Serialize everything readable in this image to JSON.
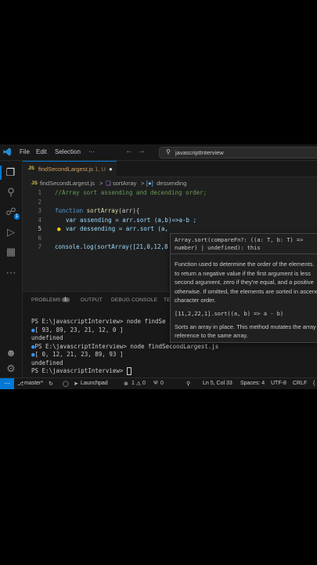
{
  "titlebar": {
    "menu": [
      "File",
      "Edit",
      "Selection",
      "···"
    ],
    "search_text": "javascriptInterview"
  },
  "tab": {
    "name": "findSecondLargest.js",
    "suffix": "1, U",
    "lang": "JS"
  },
  "breadcrumbs": [
    "findSecondLargest.js",
    ">",
    "sortArray",
    ">",
    "dessending"
  ],
  "editor": {
    "line_numbers": [
      "1",
      "2",
      "3",
      "4",
      "5",
      "6",
      "7"
    ],
    "line1": "//Array sort assending and decending order;",
    "line3_kw": "function ",
    "line3_fn": "sortArray",
    "line3_rest": "(arr){",
    "line4": "var assending = arr.sort (a,b)=>a-b ;",
    "line5": "var dessending = arr.sort (a,",
    "line7": "console.log(sortArray([21,0,12,8"
  },
  "hover": {
    "signature": "Array.sort(compareFn?: ((a: T, b: T) => number) | undefined): this",
    "desc": [
      "Function used to determine the order of the elements.",
      "to return a negative value if the first argument is less",
      "second argument, zero if they're equal, and a positive",
      "otherwise. If omitted, the elements are sorted in ascending",
      "character order."
    ],
    "example": "[11,2,22,1].sort((a, b) => a - b)",
    "sorts": [
      "Sorts an array in place. This method mutates the array",
      "reference to the same array."
    ]
  },
  "panel": {
    "tabs": [
      "PROBLEMS",
      "OUTPUT",
      "DEBUG CONSOLE",
      "TE"
    ],
    "problems_count": "1",
    "terminal": [
      "PS E:\\javascriptInterview> node findSe",
      "[ 93, 89, 23, 21, 12, 0 ]",
      "undefined",
      "PS E:\\javascriptInterview> node findSecondLargest.js",
      "[ 0, 12, 21, 23, 89, 93 ]",
      "undefined",
      "PS E:\\javascriptInterview> "
    ]
  },
  "status": {
    "branch": "master*",
    "launchpad": "Launchpad",
    "errors": "1",
    "warnings": "0",
    "ports": "0",
    "position": "Ln 5, Col 33",
    "spaces": "Spaces: 4",
    "encoding": "UTF-8",
    "eol": "CRLF",
    "lang": "{"
  },
  "colors": {
    "accent": "#0078d4",
    "background": "#1f1f1f"
  }
}
